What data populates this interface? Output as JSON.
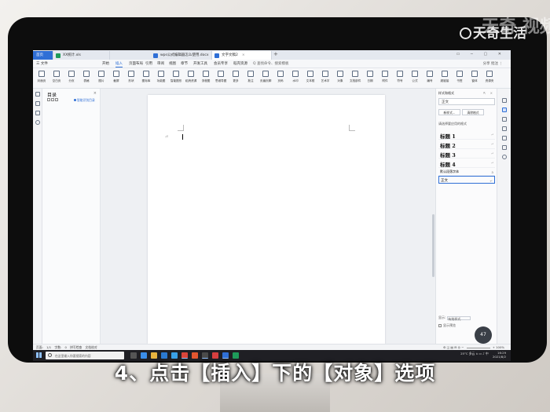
{
  "caption": "4、点击【插入】下的【对象】选项",
  "watermark": {
    "brand": "天奇生活",
    "big": "天奇 视频"
  },
  "tabs": [
    {
      "label": "首页",
      "icon": "home-icon",
      "color": "#ffffff"
    },
    {
      "label": "XX统计.xls",
      "icon": "spreadsheet-icon",
      "color": "#1e9b5a"
    },
    {
      "label": "wps公式编辑器怎么使用.docx",
      "icon": "writer-doc-icon",
      "color": "#2f6fd6"
    },
    {
      "label": "文字文稿2",
      "icon": "writer-doc-icon",
      "color": "#2f6fd6"
    }
  ],
  "new_tab": "+",
  "menu": {
    "file": "三 文件",
    "items": [
      "开始",
      "插入",
      "页面布局",
      "引用",
      "审阅",
      "视图",
      "章节",
      "开发工具",
      "会员专享",
      "稻壳资源"
    ],
    "active_index": 1,
    "search": "Q 查找命令、搜索模板",
    "right_links": "分享  批注  ⋮"
  },
  "ribbon": [
    {
      "label": "封面页",
      "icon": "cover-page-icon"
    },
    {
      "label": "空白页",
      "icon": "blank-page-icon"
    },
    {
      "label": "分页",
      "icon": "page-break-icon"
    },
    {
      "label": "表格",
      "icon": "table-icon"
    },
    {
      "label": "图片",
      "icon": "picture-icon"
    },
    {
      "label": "截屏",
      "icon": "screenshot-icon"
    },
    {
      "label": "形状",
      "icon": "shape-icon"
    },
    {
      "label": "图标库",
      "icon": "icon-library-icon"
    },
    {
      "label": "功能图",
      "icon": "function-chart-icon"
    },
    {
      "label": "智能图形",
      "icon": "smart-graphic-icon"
    },
    {
      "label": "稻壳资源",
      "icon": "resource-icon"
    },
    {
      "label": "流程图",
      "icon": "flowchart-icon"
    },
    {
      "label": "思维导图",
      "icon": "mindmap-icon"
    },
    {
      "label": "更多",
      "icon": "more-icon"
    },
    {
      "label": "批注",
      "icon": "comment-icon"
    },
    {
      "label": "页眉页脚",
      "icon": "header-footer-icon"
    },
    {
      "label": "页码",
      "icon": "page-number-icon"
    },
    {
      "label": "水印",
      "icon": "watermark-icon"
    },
    {
      "label": "文本框",
      "icon": "textbox-icon"
    },
    {
      "label": "艺术字",
      "icon": "wordart-icon"
    },
    {
      "label": "对象",
      "icon": "object-icon"
    },
    {
      "label": "文档部件",
      "icon": "doc-part-icon"
    },
    {
      "label": "日期",
      "icon": "date-icon"
    },
    {
      "label": "附件",
      "icon": "attachment-icon"
    },
    {
      "label": "符号",
      "icon": "symbol-icon"
    },
    {
      "label": "公式",
      "icon": "formula-icon"
    },
    {
      "label": "编号",
      "icon": "numbering-icon"
    },
    {
      "label": "超链接",
      "icon": "hyperlink-icon"
    },
    {
      "label": "书签",
      "icon": "bookmark-icon"
    },
    {
      "label": "窗体",
      "icon": "form-icon"
    },
    {
      "label": "资源夹",
      "icon": "resource-folder-icon"
    }
  ],
  "toc": {
    "title": "目录",
    "close": "×",
    "smart": "智能识别目录"
  },
  "document": {
    "para_mark": "⏎"
  },
  "styles": {
    "header": "样式和格式",
    "current": "正文",
    "new_style": "新样式...",
    "clear_format": "清除格式",
    "section_label": "请选择要应用的格式",
    "list": [
      "标题 1",
      "标题 2",
      "标题 3",
      "标题 4"
    ],
    "extra": "默认段落字体",
    "selected": "正文",
    "show_label": "显示:",
    "show_value": "有效样式",
    "preview_label": "显示预览"
  },
  "statusbar": {
    "left": "页面: 1/1  字数: 0  拼写检查  文档校对",
    "zoom": "100%"
  },
  "speed_badge": "47",
  "taskbar": {
    "search_placeholder": "在这里输入你要搜索的内容",
    "weather": "25°C 多云",
    "time": "16:29",
    "date": "2021/8/2"
  }
}
